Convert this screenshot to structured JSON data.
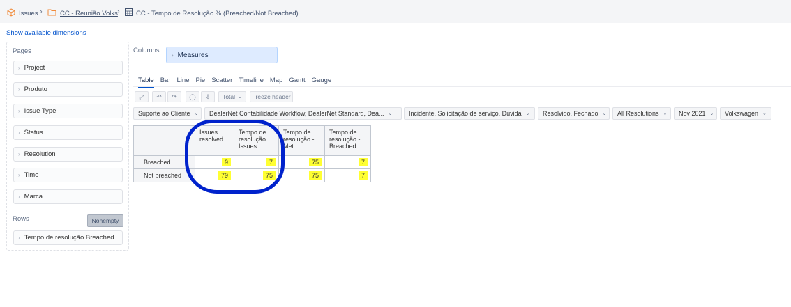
{
  "breadcrumb": {
    "items": [
      "Issues",
      "CC - Reunião Volks",
      "CC - Tempo de Resolução % (Breached/Not Breached)"
    ]
  },
  "show_dimensions": "Show available dimensions",
  "pages": {
    "label": "Pages",
    "items": [
      "Project",
      "Produto",
      "Issue Type",
      "Status",
      "Resolution",
      "Time",
      "Marca"
    ]
  },
  "rows": {
    "label": "Rows",
    "nonempty": "Nonempty",
    "items": [
      "Tempo de resolução Breached"
    ]
  },
  "columns": {
    "label": "Columns",
    "items": [
      "Measures"
    ]
  },
  "chart_tabs": [
    "Table",
    "Bar",
    "Line",
    "Pie",
    "Scatter",
    "Timeline",
    "Map",
    "Gantt",
    "Gauge"
  ],
  "active_tab": "Table",
  "toolbar": {
    "total_label": "Total",
    "freeze_label": "Freeze header"
  },
  "filters": [
    "Suporte ao Cliente",
    "DealerNet Contabilidade Workflow, DealerNet Standard, Dea...",
    "Incidente, Solicitação de serviço, Dúvida",
    "Resolvido, Fechado",
    "All Resolutions",
    "Nov 2021",
    "Volkswagen"
  ],
  "table": {
    "headers": [
      "Issues resolved",
      "Tempo de resolução Issues",
      "Tempo de resolução - Met",
      "Tempo de resolução - Breached"
    ],
    "rows": [
      {
        "label": "Breached",
        "values": [
          "9",
          "7",
          "75",
          "7"
        ]
      },
      {
        "label": "Not breached",
        "values": [
          "79",
          "75",
          "75",
          "7"
        ]
      }
    ]
  },
  "colors": {
    "highlight": "#ffff33",
    "annotation_circle": "#0022cc",
    "link": "#0052cc"
  }
}
